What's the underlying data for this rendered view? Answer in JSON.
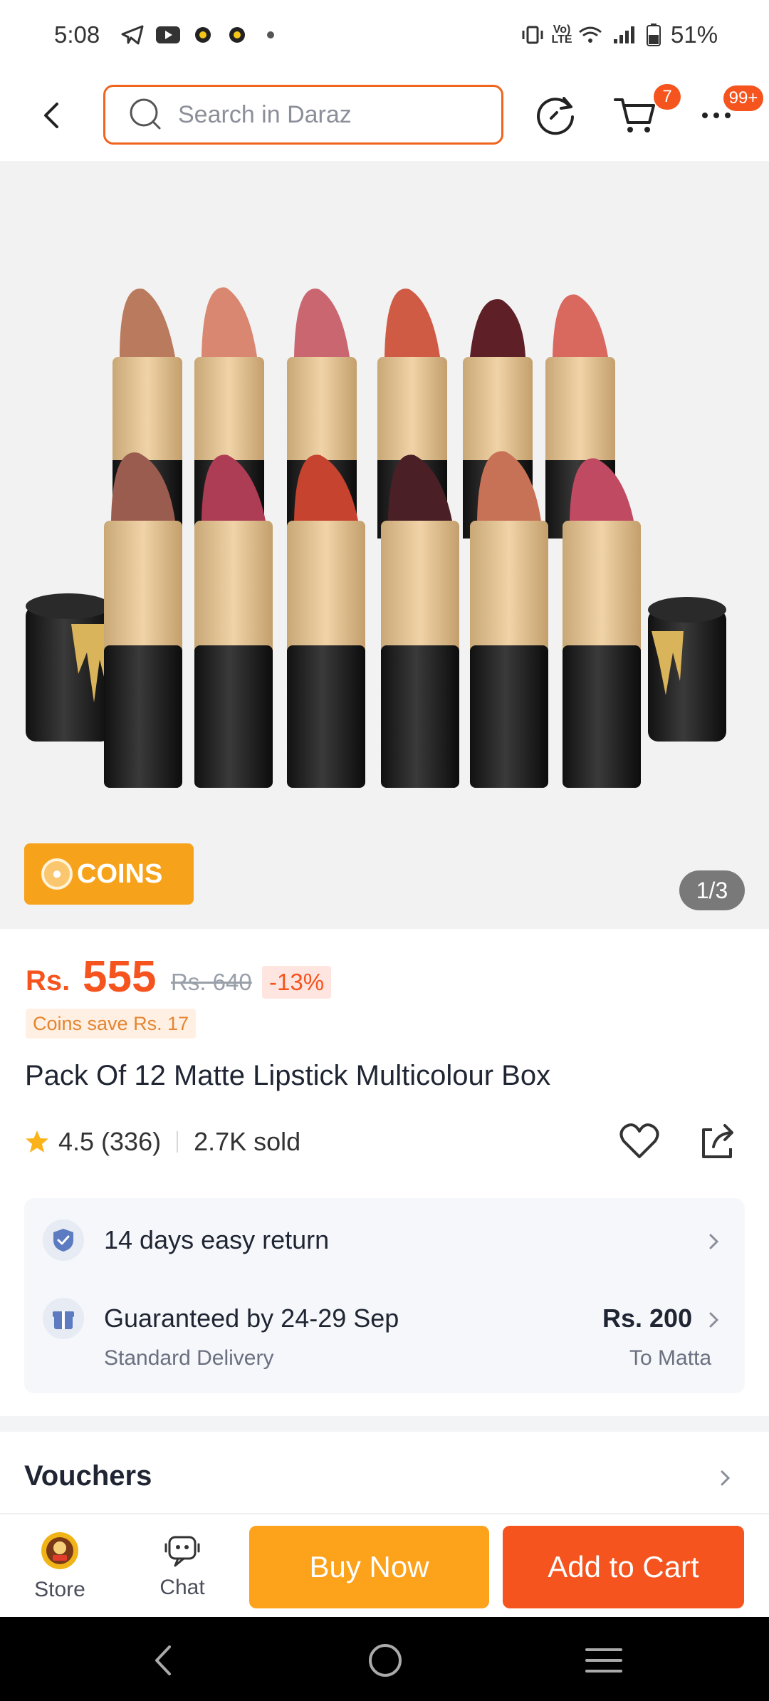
{
  "status_bar": {
    "time": "5:08",
    "battery": "51%",
    "network_label": "Vo) LTE"
  },
  "header": {
    "search_placeholder": "Search in Daraz",
    "cart_count": "7",
    "more_badge": "99+"
  },
  "gallery": {
    "coins_label": "COINS",
    "pager": "1/3"
  },
  "product": {
    "currency": "Rs.",
    "price": "555",
    "old_price": "Rs. 640",
    "discount": "-13%",
    "coins_save": "Coins save Rs. 17",
    "title": "Pack Of 12 Matte Lipstick Multicolour Box",
    "rating": "4.5",
    "reviews": "(336)",
    "sold": "2.7K sold"
  },
  "services": {
    "return_label": "14 days easy return",
    "delivery_label": "Guaranteed by 24-29 Sep",
    "delivery_sub": "Standard Delivery",
    "delivery_price": "Rs. 200",
    "delivery_to": "To Matta"
  },
  "sections": {
    "vouchers": "Vouchers"
  },
  "bottom_bar": {
    "store": "Store",
    "chat": "Chat",
    "buy_now": "Buy Now",
    "add_to_cart": "Add to Cart"
  },
  "colors": {
    "accent": "#f5541e",
    "buy": "#fca21b",
    "coins": "#f7a21b"
  }
}
